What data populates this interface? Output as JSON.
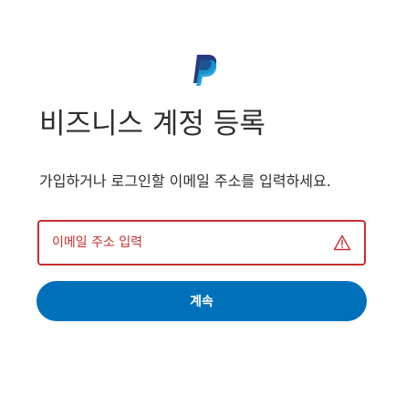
{
  "brand": {
    "logo_icon": "paypal-p-icon",
    "color_dark": "#253b80",
    "color_light": "#179bd7"
  },
  "header": {
    "title": "비즈니스 계정 등록"
  },
  "form": {
    "instruction": "가입하거나 로그인할 이메일 주소를 입력하세요.",
    "email": {
      "value": "",
      "placeholder": "이메일 주소 입력",
      "status": "error",
      "status_icon": "warning-icon",
      "error_color": "#c72e2e"
    },
    "continue_label": "계속",
    "button_color": "#0070ba"
  }
}
